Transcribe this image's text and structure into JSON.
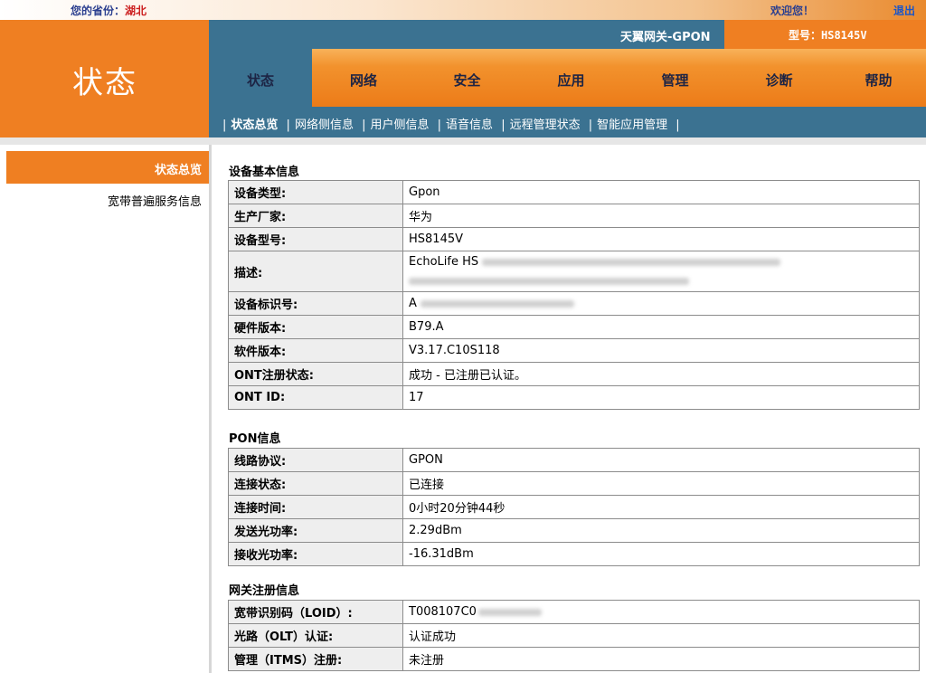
{
  "topbar": {
    "province_label": "您的省份：",
    "province_value": "湖北",
    "welcome": "欢迎您！",
    "logout": "退出"
  },
  "header": {
    "page_title": "状态",
    "gateway": "天翼网关-GPON",
    "model": "型号：HS8145V"
  },
  "nav": {
    "tabs": [
      {
        "label": "状态",
        "active": true
      },
      {
        "label": "网络"
      },
      {
        "label": "安全"
      },
      {
        "label": "应用"
      },
      {
        "label": "管理"
      },
      {
        "label": "诊断"
      },
      {
        "label": "帮助"
      }
    ]
  },
  "subnav": {
    "items": [
      {
        "label": "状态总览",
        "active": true
      },
      {
        "label": "网络侧信息"
      },
      {
        "label": "用户侧信息"
      },
      {
        "label": "语音信息"
      },
      {
        "label": "远程管理状态"
      },
      {
        "label": "智能应用管理"
      }
    ],
    "separator": "|"
  },
  "sidebar": {
    "items": [
      {
        "label": "状态总览",
        "active": true
      },
      {
        "label": "宽带普遍服务信息"
      }
    ]
  },
  "sections": {
    "device": {
      "title": "设备基本信息",
      "rows": [
        {
          "k": "设备类型:",
          "v": "Gpon"
        },
        {
          "k": "生产厂家:",
          "v": "华为"
        },
        {
          "k": "设备型号:",
          "v": "HS8145V"
        },
        {
          "k": "描述:",
          "v": "EchoLife HS"
        },
        {
          "k": "设备标识号:",
          "v": "A"
        },
        {
          "k": "硬件版本:",
          "v": "B79.A"
        },
        {
          "k": "软件版本:",
          "v": "V3.17.C10S118"
        },
        {
          "k": "ONT注册状态:",
          "v": "成功 - 已注册已认证。"
        },
        {
          "k": "ONT ID:",
          "v": "17"
        }
      ]
    },
    "pon": {
      "title": "PON信息",
      "rows": [
        {
          "k": "线路协议:",
          "v": "GPON"
        },
        {
          "k": "连接状态:",
          "v": "已连接"
        },
        {
          "k": "连接时间:",
          "v": "0小时20分钟44秒"
        },
        {
          "k": "发送光功率:",
          "v": "2.29dBm"
        },
        {
          "k": "接收光功率:",
          "v": "-16.31dBm"
        }
      ]
    },
    "gateway": {
      "title": "网关注册信息",
      "rows": [
        {
          "k": "宽带识别码（LOID）:",
          "v": "T008107C0"
        },
        {
          "k": "光路（OLT）认证:",
          "v": "认证成功"
        },
        {
          "k": "管理（ITMS）注册:",
          "v": "未注册"
        }
      ]
    }
  },
  "colors": {
    "orange": "#ef7f22",
    "teal": "#3b7291",
    "province": "#cc1f1f"
  }
}
